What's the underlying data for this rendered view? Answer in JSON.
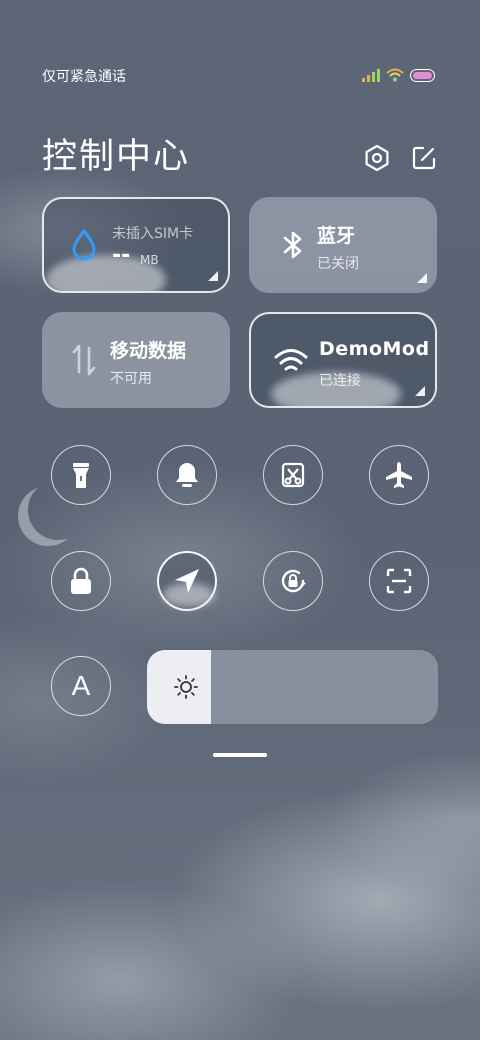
{
  "status_bar": {
    "carrier": "仅可紧急通话"
  },
  "header": {
    "title": "控制中心"
  },
  "tiles": {
    "mobile_data_usage": {
      "line1": "未插入SIM卡",
      "value": "--",
      "unit": "MB"
    },
    "bluetooth": {
      "label": "蓝牙",
      "status": "已关闭"
    },
    "mobile_data": {
      "label": "移动数据",
      "status": "不可用"
    },
    "wifi": {
      "label": "DemoMod",
      "status": "已连接"
    }
  },
  "toggles": [
    {
      "icon": "flashlight-icon",
      "active": false
    },
    {
      "icon": "bell-icon",
      "active": false
    },
    {
      "icon": "screenshot-icon",
      "active": false
    },
    {
      "icon": "airplane-icon",
      "active": false
    },
    {
      "icon": "lock-icon",
      "active": false
    },
    {
      "icon": "location-icon",
      "active": true
    },
    {
      "icon": "rotation-lock-icon",
      "active": false
    },
    {
      "icon": "scan-icon",
      "active": false
    }
  ],
  "font_button": {
    "label": "A"
  },
  "brightness": {
    "level_percent": 22
  },
  "colors": {
    "accent_blue": "#2f9bff",
    "background": "#5c6676"
  }
}
